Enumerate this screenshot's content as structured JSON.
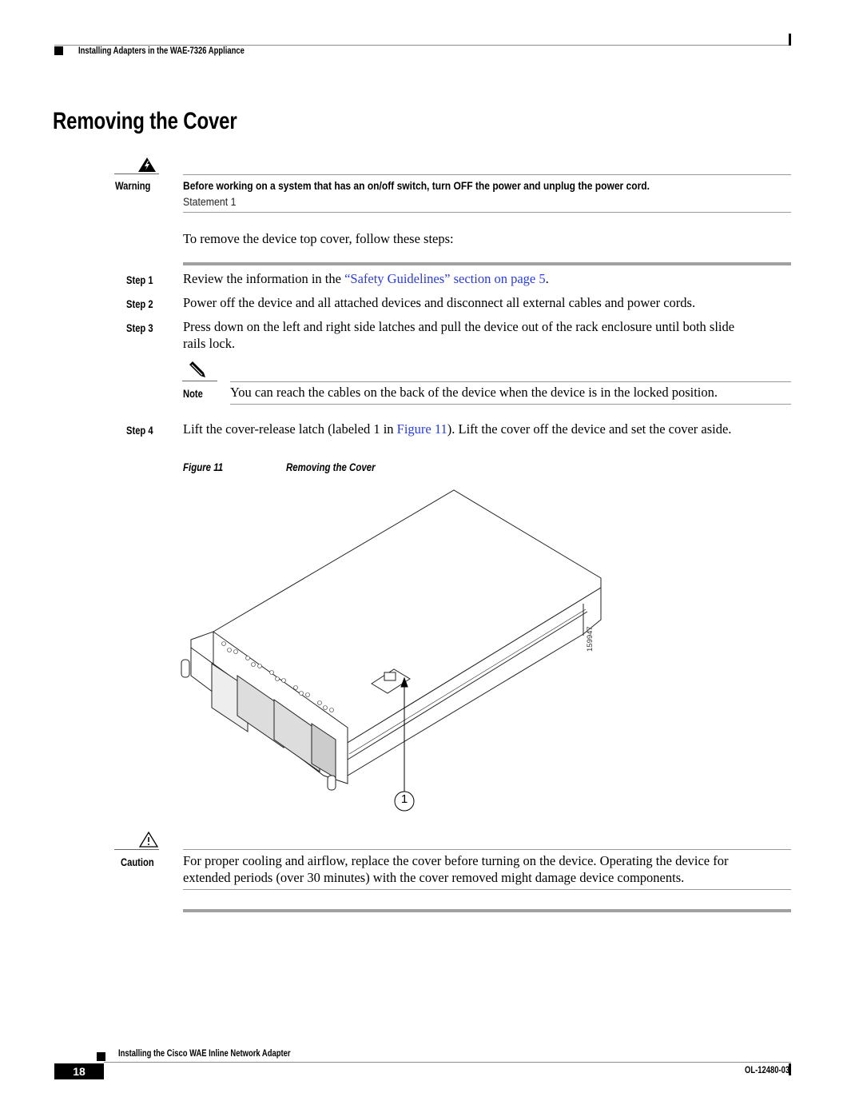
{
  "header": {
    "running_title": "Installing Adapters in the WAE-7326 Appliance"
  },
  "section": {
    "title": "Removing the Cover"
  },
  "warning": {
    "icon": "lightning-warning-icon",
    "label": "Warning",
    "text": "Before working on a system that has an on/off switch, turn OFF the power and unplug the power cord.",
    "statement": "Statement 1"
  },
  "intro": "To remove the device top cover, follow these steps:",
  "steps": [
    {
      "label": "Step 1",
      "text_before": "Review the information in the ",
      "link": "“Safety Guidelines” section on page 5",
      "text_after": "."
    },
    {
      "label": "Step 2",
      "text": "Power off the device and all attached devices and disconnect all external cables and power cords."
    },
    {
      "label": "Step 3",
      "text_line1": "Press down on the left and right side latches and pull the device out of the rack enclosure until both slide",
      "text_line2": "rails lock."
    },
    {
      "label": "Step 4",
      "text_before": "Lift the cover-release latch (labeled 1 in ",
      "link": "Figure 11",
      "text_after": "). Lift the cover off the device and set the cover aside."
    }
  ],
  "note": {
    "icon": "pencil-note-icon",
    "label": "Note",
    "text": "You can reach the cables on the back of the device when the device is in the locked position."
  },
  "figure": {
    "number_label": "Figure 11",
    "caption": "Removing the Cover",
    "callout": "1",
    "art_id": "159947"
  },
  "caution": {
    "icon": "caution-triangle-icon",
    "label": "Caution",
    "line1": "For proper cooling and airflow, replace the cover before turning on the device. Operating the device for",
    "line2": "extended periods (over 30 minutes) with the cover removed might damage device components."
  },
  "footer": {
    "book_title": "Installing the Cisco WAE Inline Network Adapter",
    "page_number": "18",
    "doc_number": "OL-12480-03"
  }
}
